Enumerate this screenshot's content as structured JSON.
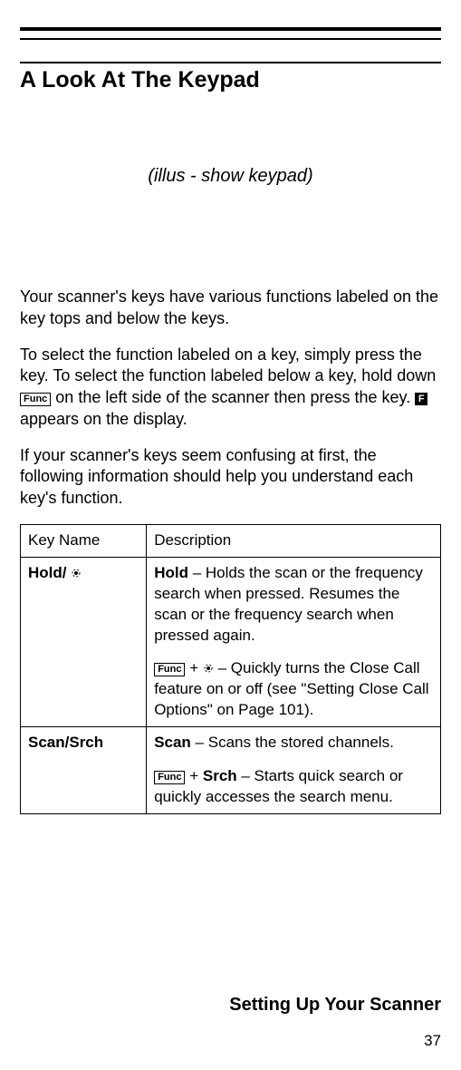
{
  "heading": "A Look At The Keypad",
  "illustration_note": "(illus - show keypad)",
  "paragraphs": {
    "p1": "Your scanner's keys have various functions labeled on the key tops and below the keys.",
    "p2a": "To select the function labeled on a key, simply press the key. To select the function labeled below a key, hold down ",
    "p2b": " on the left side of the scanner then press the key.  ",
    "p2c": " appears on the display.",
    "p3": "If your scanner's keys seem confusing at first, the following information should help you understand each key's function."
  },
  "icons": {
    "func_label": "Func",
    "f_label": "F"
  },
  "table": {
    "header_key": "Key Name",
    "header_desc": "Description",
    "rows": [
      {
        "name_prefix": "Hold/ ",
        "has_cc_icon": true,
        "desc": [
          {
            "lead_bold": "Hold",
            "text": " – Holds the scan or the frequency search when pressed. Resumes the scan or the frequency search when pressed again."
          },
          {
            "func_plus_cc": true,
            "text": " – Quickly turns the Close Call feature on or off (see \"Setting Close Call Options\" on Page 101)."
          }
        ]
      },
      {
        "name_prefix": "Scan/Srch",
        "has_cc_icon": false,
        "desc": [
          {
            "lead_bold": "Scan",
            "text": " – Scans the stored channels."
          },
          {
            "func_plus_bold": "Srch",
            "text": " – Starts quick search or quickly accesses the search menu."
          }
        ]
      }
    ]
  },
  "footer": {
    "chapter": "Setting Up Your Scanner",
    "page_number": "37"
  }
}
